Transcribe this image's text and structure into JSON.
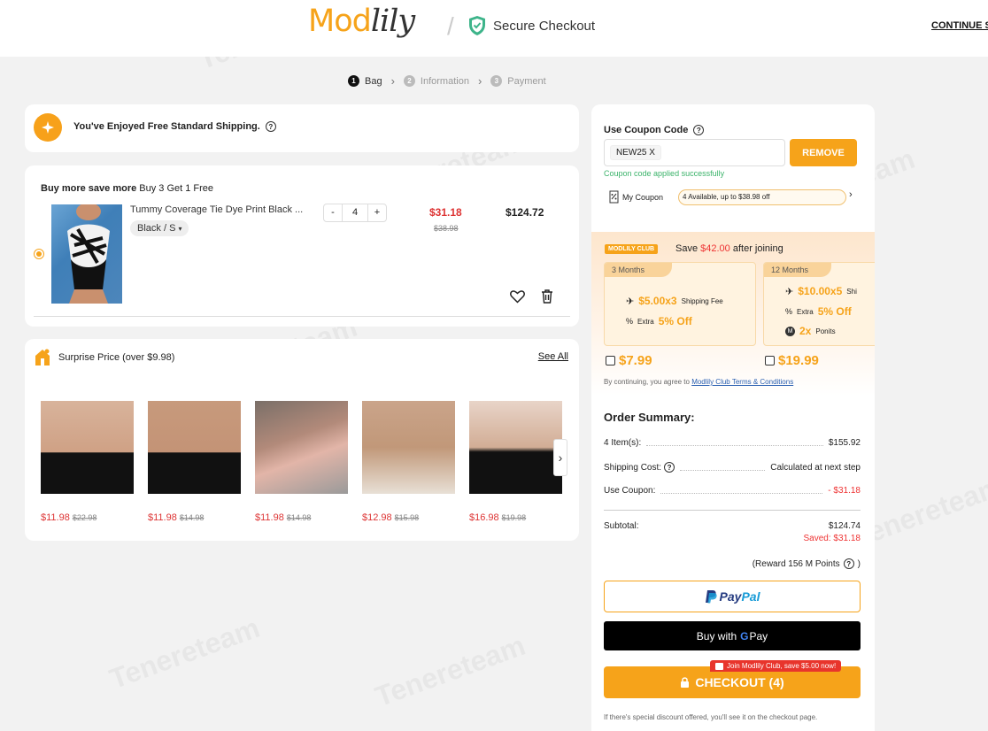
{
  "header": {
    "logo_mod": "Mod",
    "logo_lily": "lily",
    "secure_label": "Secure Checkout",
    "continue_label": "CONTINUE S"
  },
  "steps": [
    {
      "num": "1",
      "label": "Bag"
    },
    {
      "num": "2",
      "label": "Information"
    },
    {
      "num": "3",
      "label": "Payment"
    }
  ],
  "shipping": {
    "text": "You've Enjoyed Free Standard Shipping."
  },
  "bag": {
    "promo_bold": "Buy more save more",
    "promo_rest": " Buy 3 Get 1 Free",
    "item": {
      "name": "Tummy Coverage Tie Dye Print Black ...",
      "variant": "Black / S",
      "qty_minus": "-",
      "qty": "4",
      "qty_plus": "+",
      "sale_price": "$31.18",
      "orig_price": "$38.98",
      "total": "$124.72"
    }
  },
  "surprise": {
    "title": "Surprise Price (over $9.98)",
    "see_all": "See All",
    "products": [
      {
        "sale": "$11.98",
        "orig": "$22.98"
      },
      {
        "sale": "$11.98",
        "orig": "$14.98"
      },
      {
        "sale": "$11.98",
        "orig": "$14.98"
      },
      {
        "sale": "$12.98",
        "orig": "$15.98"
      },
      {
        "sale": "$16.98",
        "orig": "$19.98"
      }
    ]
  },
  "coupon": {
    "title": "Use Coupon Code",
    "code": "NEW25  X",
    "remove": "REMOVE",
    "applied": "Coupon code applied successfully",
    "my_coupon": "My Coupon",
    "available": "4 Available, up to $38.98 off"
  },
  "club": {
    "badge": "MODLILY CLUB",
    "save_pre": "Save ",
    "save_amt": "$42.00",
    "save_post": " after joining",
    "plans": [
      {
        "tag": "3 Months",
        "ship_big": "$5.00x3",
        "ship_small": "Shipping Fee",
        "extra_small": "Extra",
        "extra_big": "5% Off",
        "price": "$7.99"
      },
      {
        "tag": "12 Months",
        "ship_big": "$10.00x5",
        "ship_small": "Shi",
        "extra_small": "Extra",
        "extra_big": "5% Off",
        "points_big": "2x",
        "points_small": "Ponits",
        "price": "$19.99"
      }
    ],
    "agree_pre": "By continuing, you agree to ",
    "agree_link": "Modlily Club Terms & Conditions"
  },
  "summary": {
    "title": "Order Summary:",
    "items_label": "4 Item(s):",
    "items_value": "$155.92",
    "shipping_label": "Shipping Cost:",
    "shipping_value": "Calculated at next step",
    "coupon_label": "Use Coupon:",
    "coupon_value": "- $31.18",
    "subtotal_label": "Subtotal:",
    "subtotal_value": "$124.74",
    "saved": "Saved: $31.18",
    "reward": "(Reward 156 M Points"
  },
  "pay": {
    "paypal_pay": "Pay",
    "paypal_pal": "Pal",
    "gpay_pre": "Buy with",
    "gpay_g": "G",
    "gpay_pay": "Pay",
    "checkout": "CHECKOUT (4)",
    "join": "Join Modlily Club, save $5.00 now!",
    "disclaimer": "If there's special discount offered, you'll see it on the checkout page."
  },
  "colors": {
    "accent": "#f6a31a",
    "sale": "#dd3333",
    "success": "#3bb36a",
    "paypal_dark": "#253b80",
    "paypal_light": "#179bd7"
  }
}
